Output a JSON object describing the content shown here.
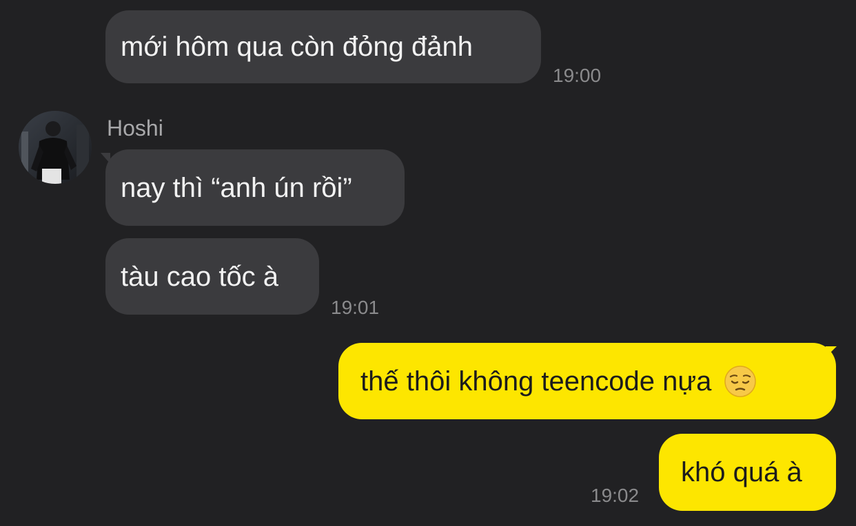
{
  "contact": {
    "name": "Hoshi"
  },
  "messages": [
    {
      "direction": "incoming",
      "text": "mới hôm qua còn đỏng đảnh",
      "time": "19:00"
    },
    {
      "direction": "incoming",
      "text": "nay thì “anh ún rồi”",
      "time": ""
    },
    {
      "direction": "incoming",
      "text": "tàu cao tốc à",
      "time": "19:01"
    },
    {
      "direction": "outgoing",
      "text": "thế thôi không teencode nựa",
      "emoji": "pensive-face",
      "time": ""
    },
    {
      "direction": "outgoing",
      "text": "khó quá à",
      "time": "19:02"
    }
  ],
  "colors": {
    "background": "#212123",
    "incoming_bubble": "#3b3b3e",
    "outgoing_bubble": "#fde600",
    "timestamp": "#8a8a8c"
  }
}
